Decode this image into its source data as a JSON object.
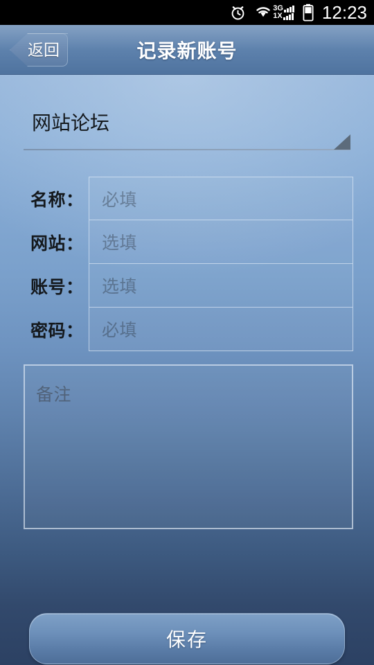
{
  "status_bar": {
    "time": "12:23",
    "icons": [
      {
        "name": "alarm-icon",
        "label": "alarm"
      },
      {
        "name": "wifi-icon",
        "label": "wifi"
      },
      {
        "name": "signal-3g-icon",
        "label": "3G"
      },
      {
        "name": "signal-1x-icon",
        "label": "1X"
      },
      {
        "name": "battery-icon",
        "label": "battery"
      }
    ],
    "network_labels": {
      "primary": "3G",
      "secondary": "1X"
    },
    "colors": {
      "background": "#000000",
      "foreground": "#ffffff"
    }
  },
  "title_bar": {
    "back_label": "返回",
    "title": "记录新账号",
    "colors": {
      "gradient_top": "#6d8fb8",
      "gradient_bottom": "#4f739f",
      "text": "#ffffff"
    }
  },
  "form": {
    "category_spinner": {
      "value": "网站论坛",
      "caret_icon": "triangle-down-icon"
    },
    "fields": [
      {
        "label": "名称：",
        "placeholder": "必填",
        "value": "",
        "name": "name-field"
      },
      {
        "label": "网站：",
        "placeholder": "选填",
        "value": "",
        "name": "website-field"
      },
      {
        "label": "账号：",
        "placeholder": "选填",
        "value": "",
        "name": "account-field"
      },
      {
        "label": "密码：",
        "placeholder": "必填",
        "value": "",
        "name": "password-field"
      }
    ],
    "notes": {
      "placeholder": "备注",
      "value": ""
    },
    "save_label": "保存"
  },
  "theme": {
    "body_gradient_top": "#93b4da",
    "body_gradient_bottom": "#2c4163",
    "field_border": "#e8f0fa",
    "placeholder_text": "#6b7280",
    "label_text": "#14181c",
    "button_accent": "#6d90ba"
  }
}
